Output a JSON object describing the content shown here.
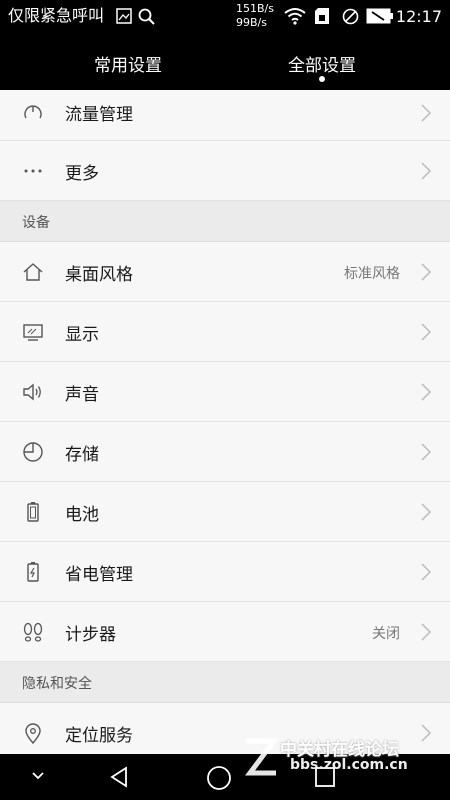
{
  "status": {
    "emergency_text": "仅限紧急呼叫",
    "speed_up": "151B/s",
    "speed_down": "99B/s",
    "time": "12:17"
  },
  "tabs": [
    {
      "label": "常用设置"
    },
    {
      "label": "全部设置"
    }
  ],
  "rows_top": [
    {
      "label": "流量管理",
      "icon": "gauge-icon"
    },
    {
      "label": "更多",
      "icon": "more-icon"
    }
  ],
  "section_device": "设备",
  "rows_device": [
    {
      "label": "桌面风格",
      "value": "标准风格",
      "icon": "home-icon"
    },
    {
      "label": "显示",
      "icon": "display-icon"
    },
    {
      "label": "声音",
      "icon": "speaker-icon"
    },
    {
      "label": "存储",
      "icon": "storage-icon"
    },
    {
      "label": "电池",
      "icon": "battery-icon"
    },
    {
      "label": "省电管理",
      "icon": "power-save-icon"
    },
    {
      "label": "计步器",
      "value": "关闭",
      "icon": "footsteps-icon"
    }
  ],
  "section_privacy": "隐私和安全",
  "rows_privacy": [
    {
      "label": "定位服务",
      "icon": "location-icon"
    }
  ],
  "watermark": {
    "title": "中关村在线论坛",
    "url": "bbs.zol.com.cn"
  }
}
